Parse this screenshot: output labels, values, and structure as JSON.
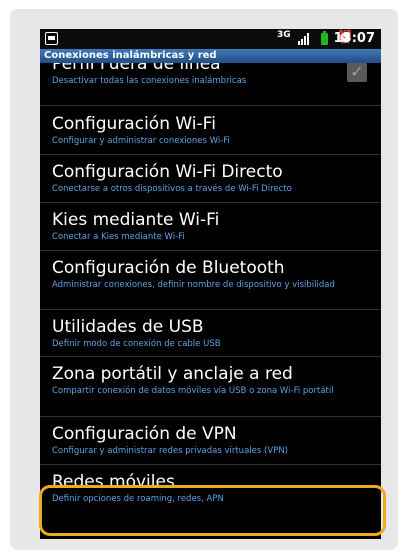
{
  "status_bar": {
    "app_icon": "sd-card-icon",
    "network_label": "3G",
    "signal_icon": "signal-bars-icon",
    "battery_icon": "battery-icon",
    "alarm_icon": "alarm-icon",
    "time": "13:07"
  },
  "title_bar": {
    "title": "Conexiones inalámbricas y red"
  },
  "settings": {
    "items": [
      {
        "title": "Perfil Fuera de línea",
        "subtitle": "Desactivar todas las conexiones inalámbricas",
        "checkbox_checked": true
      },
      {
        "title": "Configuración Wi-Fi",
        "subtitle": "Configurar y administrar conexiones Wi-Fi"
      },
      {
        "title": "Configuración Wi-Fi Directo",
        "subtitle": "Conectarse a otros dispositivos a través de Wi-Fi Directo"
      },
      {
        "title": "Kies mediante Wi-Fi",
        "subtitle": "Conectar a Kies mediante Wi-Fi"
      },
      {
        "title": "Configuración de Bluetooth",
        "subtitle": "Administrar conexiones, definir nombre de dispositivo y visibilidad"
      },
      {
        "title": "Utilidades de USB",
        "subtitle": "Definir modo de conexión de cable USB"
      },
      {
        "title": "Zona portátil y anclaje a red",
        "subtitle": "Compartir conexión de datos móviles vía USB o zona Wi-Fi portátil"
      },
      {
        "title": "Configuración de VPN",
        "subtitle": "Configurar y administrar redes privadas virtuales (VPN)"
      },
      {
        "title": "Redes móviles",
        "subtitle": "Definir opciones de roaming, redes, APN"
      }
    ]
  },
  "colors": {
    "title_bar": "#2c5f9e",
    "subtitle_text": "#5ba3e6",
    "highlight_outline": "#f0a81c",
    "battery": "#23b81f"
  }
}
